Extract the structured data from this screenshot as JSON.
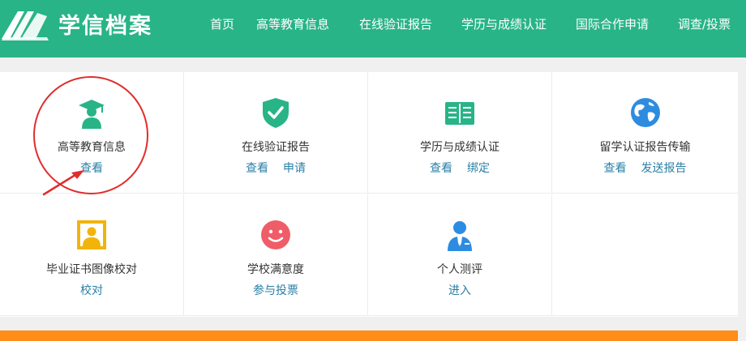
{
  "header": {
    "brand": "学信档案",
    "nav": [
      "首页",
      "高等教育信息",
      "在线验证报告",
      "学历与成绩认证",
      "国际合作申请",
      "调查/投票"
    ]
  },
  "cards": [
    {
      "title": "高等教育信息",
      "links": [
        "查看"
      ],
      "icon": "graduate-icon",
      "color": "#28b486"
    },
    {
      "title": "在线验证报告",
      "links": [
        "查看",
        "申请"
      ],
      "icon": "shield-check-icon",
      "color": "#28b486"
    },
    {
      "title": "学历与成绩认证",
      "links": [
        "查看",
        "绑定"
      ],
      "icon": "open-book-icon",
      "color": "#28b486"
    },
    {
      "title": "留学认证报告传输",
      "links": [
        "查看",
        "发送报告"
      ],
      "icon": "globe-icon",
      "color": "#2d8ce0"
    },
    {
      "title": "毕业证书图像校对",
      "links": [
        "校对"
      ],
      "icon": "portrait-icon",
      "color": "#f2b40b"
    },
    {
      "title": "学校满意度",
      "links": [
        "参与投票"
      ],
      "icon": "smiley-icon",
      "color": "#ef5d68"
    },
    {
      "title": "个人测评",
      "links": [
        "进入"
      ],
      "icon": "person-tie-icon",
      "color": "#2d8ce0"
    }
  ],
  "annotation": {
    "color": "#e02d2d",
    "highlighted_card": "高等教育信息"
  }
}
